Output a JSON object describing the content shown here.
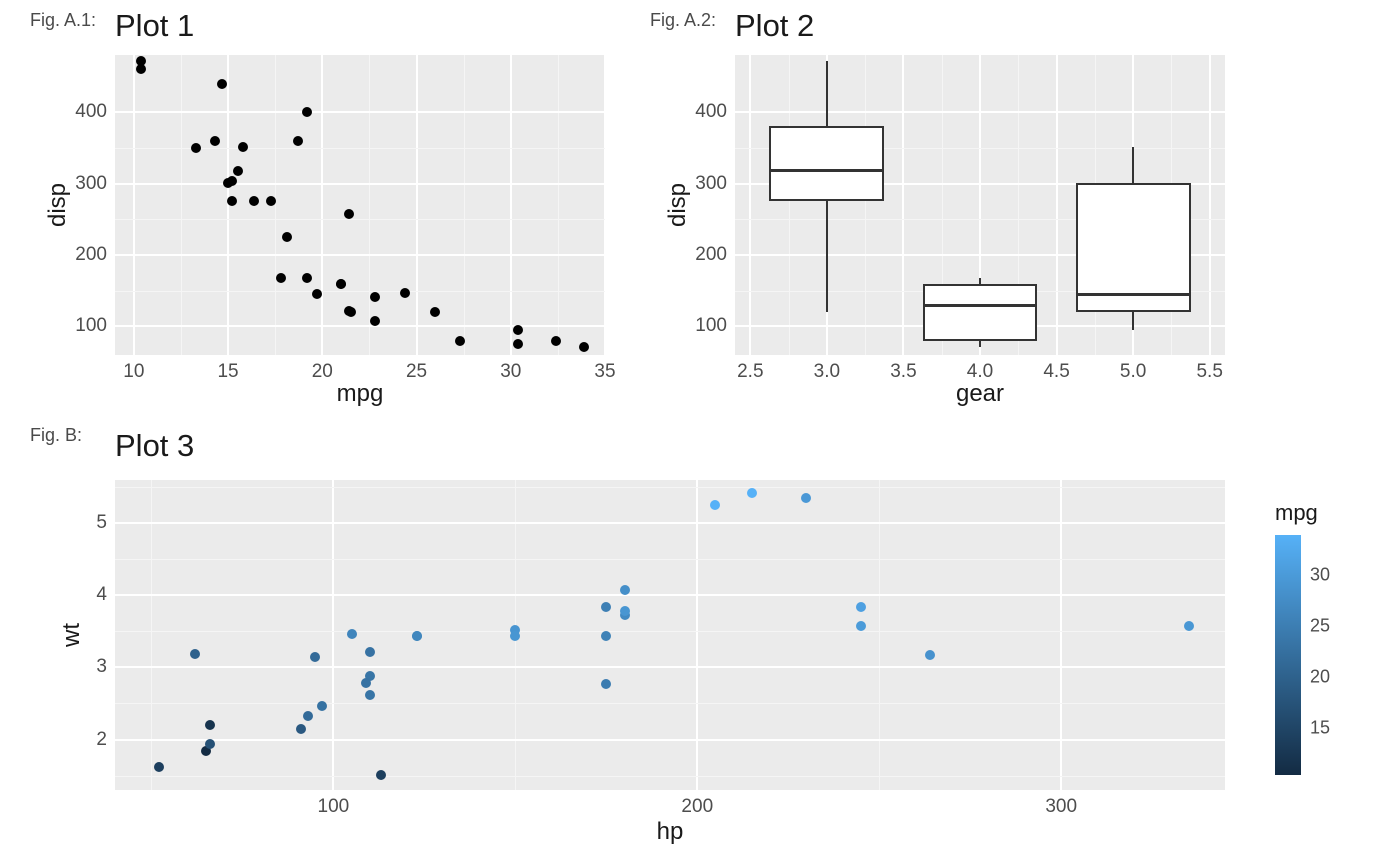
{
  "figA1": {
    "label": "Fig. A.1:",
    "title": "Plot 1",
    "xlabel": "mpg",
    "ylabel": "disp"
  },
  "figA2": {
    "label": "Fig. A.2:",
    "title": "Plot 2",
    "xlabel": "gear",
    "ylabel": "disp"
  },
  "figB": {
    "label": "Fig. B:",
    "title": "Plot 3",
    "xlabel": "hp",
    "ylabel": "wt"
  },
  "legend": {
    "title": "mpg",
    "ticks": [
      "15",
      "20",
      "25",
      "30"
    ]
  },
  "chart_data": [
    {
      "id": "A.1",
      "type": "scatter",
      "title": "Plot 1",
      "xlabel": "mpg",
      "ylabel": "disp",
      "x_ticks": [
        10,
        15,
        20,
        25,
        30,
        35
      ],
      "y_ticks": [
        100,
        200,
        300,
        400
      ],
      "xlim": [
        9,
        35
      ],
      "ylim": [
        60,
        480
      ],
      "points": [
        {
          "x": 21.0,
          "y": 160
        },
        {
          "x": 21.0,
          "y": 160
        },
        {
          "x": 22.8,
          "y": 108
        },
        {
          "x": 21.4,
          "y": 258
        },
        {
          "x": 18.7,
          "y": 360
        },
        {
          "x": 18.1,
          "y": 225
        },
        {
          "x": 14.3,
          "y": 360
        },
        {
          "x": 24.4,
          "y": 147
        },
        {
          "x": 22.8,
          "y": 141
        },
        {
          "x": 19.2,
          "y": 168
        },
        {
          "x": 17.8,
          "y": 168
        },
        {
          "x": 16.4,
          "y": 276
        },
        {
          "x": 17.3,
          "y": 276
        },
        {
          "x": 15.2,
          "y": 276
        },
        {
          "x": 10.4,
          "y": 472
        },
        {
          "x": 10.4,
          "y": 460
        },
        {
          "x": 14.7,
          "y": 440
        },
        {
          "x": 32.4,
          "y": 79
        },
        {
          "x": 30.4,
          "y": 76
        },
        {
          "x": 33.9,
          "y": 71
        },
        {
          "x": 21.5,
          "y": 120
        },
        {
          "x": 15.5,
          "y": 318
        },
        {
          "x": 15.2,
          "y": 304
        },
        {
          "x": 13.3,
          "y": 350
        },
        {
          "x": 19.2,
          "y": 400
        },
        {
          "x": 27.3,
          "y": 79
        },
        {
          "x": 26.0,
          "y": 120
        },
        {
          "x": 30.4,
          "y": 95
        },
        {
          "x": 15.8,
          "y": 351
        },
        {
          "x": 19.7,
          "y": 145
        },
        {
          "x": 15.0,
          "y": 301
        },
        {
          "x": 21.4,
          "y": 121
        }
      ]
    },
    {
      "id": "A.2",
      "type": "box",
      "title": "Plot 2",
      "xlabel": "gear",
      "ylabel": "disp",
      "x_ticks": [
        2.5,
        3.0,
        3.5,
        4.0,
        4.5,
        5.0,
        5.5
      ],
      "y_ticks": [
        100,
        200,
        300,
        400
      ],
      "xlim": [
        2.4,
        5.6
      ],
      "ylim": [
        60,
        480
      ],
      "boxes": [
        {
          "x": 3,
          "min": 120,
          "q1": 276,
          "median": 318,
          "q3": 380,
          "max": 472
        },
        {
          "x": 4,
          "min": 71,
          "q1": 79,
          "median": 130,
          "q3": 160,
          "max": 168
        },
        {
          "x": 5,
          "min": 95,
          "q1": 120,
          "median": 145,
          "q3": 301,
          "max": 351
        }
      ]
    },
    {
      "id": "B",
      "type": "scatter",
      "title": "Plot 3",
      "xlabel": "hp",
      "ylabel": "wt",
      "color_aes": "mpg",
      "color_scale": {
        "low": "#56B1F7",
        "high": "#132B43",
        "domain": [
          10.4,
          33.9
        ]
      },
      "x_ticks": [
        100,
        200,
        300
      ],
      "y_ticks": [
        2,
        3,
        4,
        5
      ],
      "xlim": [
        40,
        345
      ],
      "ylim": [
        1.3,
        5.6
      ],
      "legend_ticks": [
        15,
        20,
        25,
        30
      ],
      "points": [
        {
          "x": 110,
          "y": 2.62,
          "c": 21.0
        },
        {
          "x": 110,
          "y": 2.875,
          "c": 21.0
        },
        {
          "x": 93,
          "y": 2.32,
          "c": 22.8
        },
        {
          "x": 110,
          "y": 3.215,
          "c": 21.4
        },
        {
          "x": 175,
          "y": 3.44,
          "c": 18.7
        },
        {
          "x": 105,
          "y": 3.46,
          "c": 18.1
        },
        {
          "x": 245,
          "y": 3.57,
          "c": 14.3
        },
        {
          "x": 62,
          "y": 3.19,
          "c": 24.4
        },
        {
          "x": 95,
          "y": 3.15,
          "c": 22.8
        },
        {
          "x": 123,
          "y": 3.44,
          "c": 19.2
        },
        {
          "x": 123,
          "y": 3.44,
          "c": 17.8
        },
        {
          "x": 180,
          "y": 4.07,
          "c": 16.4
        },
        {
          "x": 180,
          "y": 3.73,
          "c": 17.3
        },
        {
          "x": 180,
          "y": 3.78,
          "c": 15.2
        },
        {
          "x": 205,
          "y": 5.25,
          "c": 10.4
        },
        {
          "x": 215,
          "y": 5.424,
          "c": 10.4
        },
        {
          "x": 230,
          "y": 5.345,
          "c": 14.7
        },
        {
          "x": 66,
          "y": 2.2,
          "c": 32.4
        },
        {
          "x": 52,
          "y": 1.615,
          "c": 30.4
        },
        {
          "x": 65,
          "y": 1.835,
          "c": 33.9
        },
        {
          "x": 97,
          "y": 2.465,
          "c": 21.5
        },
        {
          "x": 150,
          "y": 3.52,
          "c": 15.5
        },
        {
          "x": 150,
          "y": 3.435,
          "c": 15.2
        },
        {
          "x": 245,
          "y": 3.84,
          "c": 13.3
        },
        {
          "x": 175,
          "y": 3.845,
          "c": 19.2
        },
        {
          "x": 66,
          "y": 1.935,
          "c": 27.3
        },
        {
          "x": 91,
          "y": 2.14,
          "c": 26.0
        },
        {
          "x": 113,
          "y": 1.513,
          "c": 30.4
        },
        {
          "x": 264,
          "y": 3.17,
          "c": 15.8
        },
        {
          "x": 175,
          "y": 2.77,
          "c": 19.7
        },
        {
          "x": 335,
          "y": 3.57,
          "c": 15.0
        },
        {
          "x": 109,
          "y": 2.78,
          "c": 21.4
        }
      ]
    }
  ]
}
